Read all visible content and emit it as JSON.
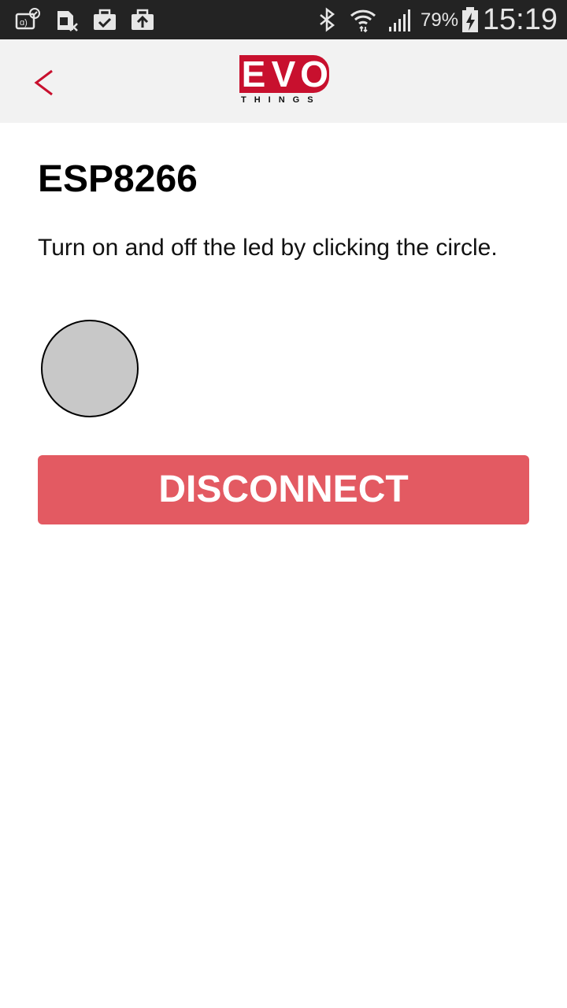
{
  "status_bar": {
    "left_icons": [
      "nfc-icon",
      "sim-disabled-icon",
      "download-done-icon",
      "upload-icon"
    ],
    "right_icons": [
      "bluetooth-icon",
      "wifi-icon",
      "signal-icon",
      "battery-charging-icon"
    ],
    "battery_percent": "79%",
    "time": "15:19"
  },
  "header": {
    "back_icon": "chevron-left-icon",
    "logo_letters": [
      "E",
      "V",
      "O"
    ],
    "logo_subtext": "THINGS",
    "back_color": "#c8102e",
    "brand_color": "#c8102e"
  },
  "main": {
    "title": "ESP8266",
    "instructions": "Turn on and off the led by clicking the circle.",
    "led_state_color": "#c8c8c8",
    "disconnect_label": "DISCONNECT",
    "disconnect_color": "#e35a62"
  }
}
